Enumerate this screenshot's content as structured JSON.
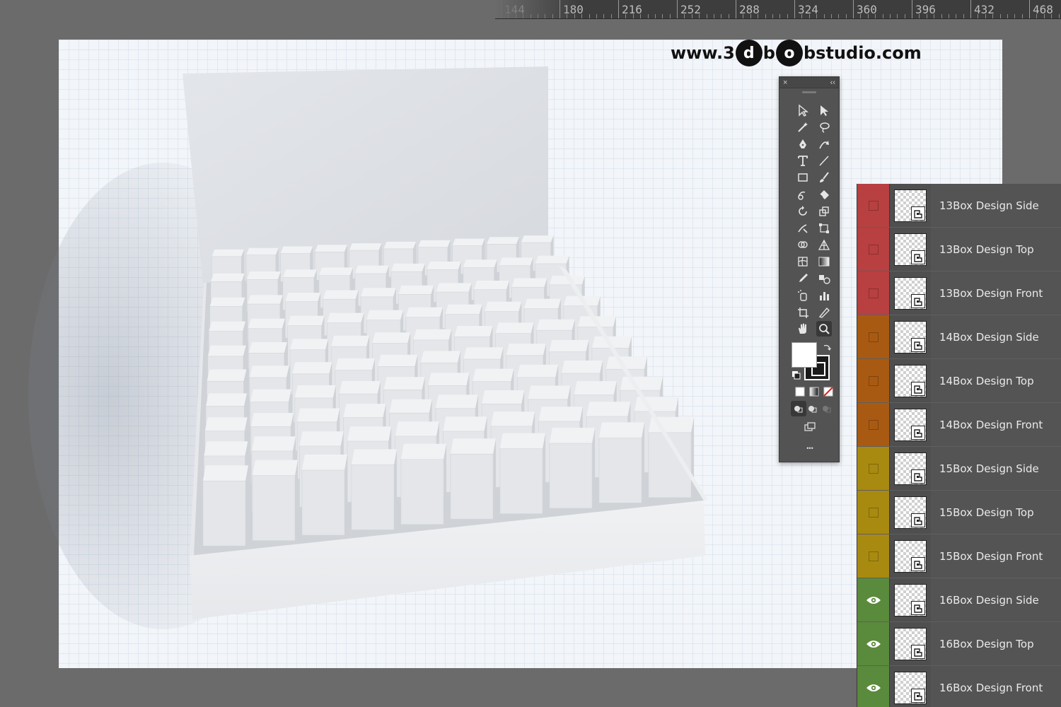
{
  "ruler": {
    "labels": [
      "144",
      "180",
      "216",
      "252",
      "288",
      "324",
      "360",
      "396",
      "432",
      "468"
    ]
  },
  "watermark": {
    "prefix": "www.3",
    "bubble_1": "d",
    "middle": "b",
    "bubble_2": "o",
    "suffix": "bstudio.com"
  },
  "toolbar": {
    "close": "×",
    "collapse": "‹‹",
    "more": "•••",
    "tools": [
      "selection-tool",
      "direct-selection-tool",
      "magic-wand-tool",
      "lasso-tool",
      "pen-tool",
      "curvature-tool",
      "type-tool",
      "line-segment-tool",
      "rectangle-tool",
      "paintbrush-tool",
      "shaper-tool",
      "eraser-tool",
      "rotate-tool",
      "scale-tool",
      "warp-tool",
      "free-transform-tool",
      "shape-builder-tool",
      "perspective-grid-tool",
      "mesh-tool",
      "gradient-tool",
      "eyedropper-tool",
      "blend-tool",
      "symbol-sprayer-tool",
      "column-graph-tool",
      "artboard-tool",
      "slice-tool",
      "hand-tool",
      "zoom-tool"
    ],
    "fill_color": "#ffffff",
    "stroke_color": "#1a1a1a"
  },
  "layers": [
    {
      "name": "13Box Design Side",
      "color": "#b84040",
      "visible": false
    },
    {
      "name": "13Box Design Top",
      "color": "#b84040",
      "visible": false
    },
    {
      "name": "13Box Design Front",
      "color": "#b84040",
      "visible": false
    },
    {
      "name": "14Box Design Side",
      "color": "#a95a12",
      "visible": false
    },
    {
      "name": "14Box Design Top",
      "color": "#a95a12",
      "visible": false
    },
    {
      "name": "14Box Design Front",
      "color": "#a95a12",
      "visible": false
    },
    {
      "name": "15Box Design Side",
      "color": "#a88a10",
      "visible": false
    },
    {
      "name": "15Box Design Top",
      "color": "#a88a10",
      "visible": false
    },
    {
      "name": "15Box Design Front",
      "color": "#a88a10",
      "visible": false
    },
    {
      "name": "16Box Design Side",
      "color": "#5a8a3c",
      "visible": true
    },
    {
      "name": "16Box Design Top",
      "color": "#5a8a3c",
      "visible": true
    },
    {
      "name": "16Box Design Front",
      "color": "#5a8a3c",
      "visible": true
    }
  ]
}
